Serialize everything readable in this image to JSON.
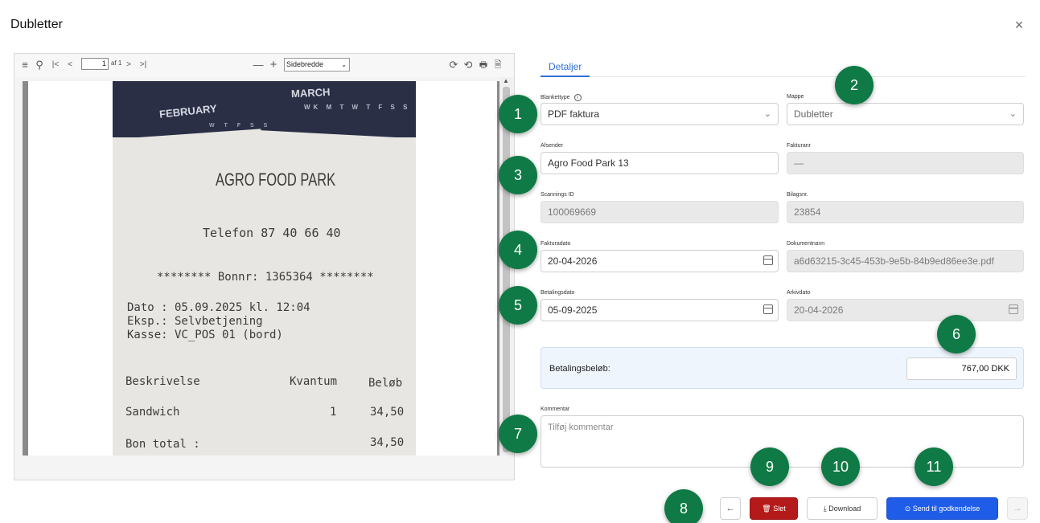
{
  "dialog": {
    "title": "Dubletter",
    "close": "×"
  },
  "viewer": {
    "toolbar": {
      "menu": "≡",
      "search": "⚲",
      "first": "|<",
      "prev": "<",
      "page": "1",
      "of": "af 1",
      "next": ">",
      "last": ">|",
      "zoom_out": "—",
      "zoom_in": "+",
      "zoom_value": "Sidebredde",
      "rotate_cw": "⟳",
      "rotate_ccw": "⟲",
      "print": "🖶",
      "save": "🗎"
    },
    "receipt": {
      "cal_feb": "FEBRUARY",
      "cal_mar": "MARCH",
      "store": "AGRO FOOD PARK",
      "phone": "Telefon 87 40 66 40",
      "bonnr": "******** Bonnr: 1365364 ********",
      "dato": "Dato : 05.09.2025 kl. 12:04",
      "eksp": "Eksp.: Selvbetjening",
      "kasse": "Kasse: VC_POS 01 (bord)",
      "col_desc": "Beskrivelse",
      "col_qty": "Kvantum",
      "col_amount": "Beløb",
      "item_name": "Sandwich",
      "item_qty": "1",
      "item_amount": "34,50",
      "total_label": "Bon total :",
      "total_amount": "34,50"
    }
  },
  "details": {
    "tab": "Detaljer",
    "blanket_label": "Blankettype",
    "blanket_value": "PDF faktura",
    "mappe_label": "Mappe",
    "mappe_value": "Dubletter",
    "afsender_label": "Afsender",
    "afsender_value": "Agro Food Park 13",
    "fakturanr_label": "Fakturanr",
    "fakturanr_value": "—",
    "scannings_label": "Scannings ID",
    "scannings_value": "100069669",
    "bilags_label": "Bilagsnr.",
    "bilags_value": "23854",
    "fakturadato_label": "Fakturadato",
    "fakturadato_value": "20-04-2026",
    "dokument_label": "Dokumentnavn",
    "dokument_value": "a6d63215-3c45-453b-9e5b-84b9ed86ee3e.pdf",
    "betalingsdato_label": "Betalingsdato",
    "betalingsdato_value": "05-09-2025",
    "arkivdato_label": "Arkivdato",
    "arkivdato_value": "20-04-2026",
    "amount_label": "Betalingsbeløb:",
    "amount_value": "767,00 DKK",
    "kommentar_label": "Kommentar",
    "kommentar_placeholder": "Tilføj kommentar"
  },
  "buttons": {
    "prev": "←",
    "delete": "Slet",
    "download": "Download",
    "send": "Send til godkendelse",
    "next": "→"
  },
  "badges": [
    "1",
    "2",
    "3",
    "4",
    "5",
    "6",
    "7",
    "8",
    "9",
    "10",
    "11"
  ],
  "colors": {
    "accent": "#2f6fd6",
    "badge": "#0f7a45",
    "delete": "#b51a1a",
    "send": "#1f5ce8"
  }
}
